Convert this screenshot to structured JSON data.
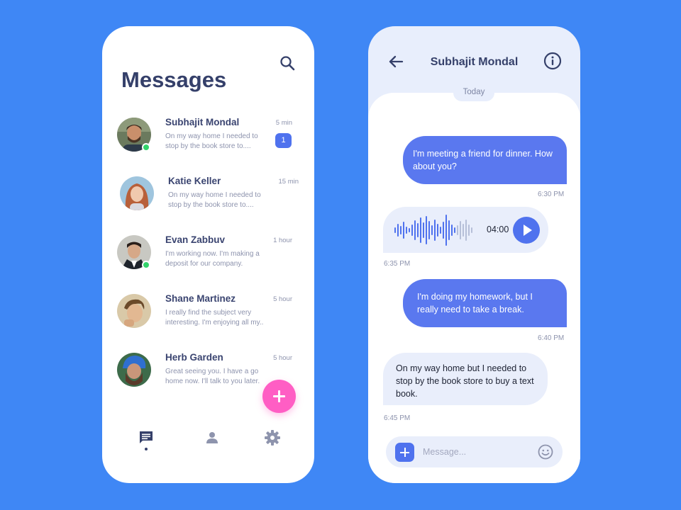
{
  "inbox": {
    "title": "Messages",
    "conversations": [
      {
        "name": "Subhajit Mondal",
        "preview": "On my way home I needed to stop by the book store to....",
        "time": "5 min",
        "unread": "1",
        "online": true
      },
      {
        "name": "Katie Keller",
        "preview": "On my way home I needed to stop by the book store to....",
        "time": "15 min",
        "unread": "",
        "online": false
      },
      {
        "name": "Evan Zabbuv",
        "preview": "I'm working now. I'm making a deposit for our company.",
        "time": "1 hour",
        "unread": "",
        "online": true
      },
      {
        "name": "Shane Martinez",
        "preview": "I really find the subject very interesting. I'm enjoying all my..",
        "time": "5 hour",
        "unread": "",
        "online": false
      },
      {
        "name": "Herb Garden",
        "preview": "Great seeing you. I have a go home now. I'll talk to you later.",
        "time": "5 hour",
        "unread": "",
        "online": false
      }
    ],
    "nav": [
      "chat-icon",
      "person-icon",
      "gear-icon"
    ]
  },
  "chat": {
    "contact_name": "Subhajit Mondal",
    "day_label": "Today",
    "messages": [
      {
        "text": "I'm meeting a friend for dinner. How about you?",
        "time": "6:30 PM"
      },
      {
        "voice_duration": "04:00",
        "time": "6:35 PM"
      },
      {
        "text": "I'm doing my homework, but I really need to take a break.",
        "time": "6:40 PM"
      },
      {
        "text": "On my way home but I needed to stop by the book store to buy a text book.",
        "time": "6:45 PM"
      }
    ],
    "composer_placeholder": "Message..."
  },
  "colors": {
    "background": "#3f87f5",
    "accent": "#4f72ee",
    "fab": "#ff5ec4",
    "online": "#33d36b",
    "title_text": "#35406a"
  }
}
